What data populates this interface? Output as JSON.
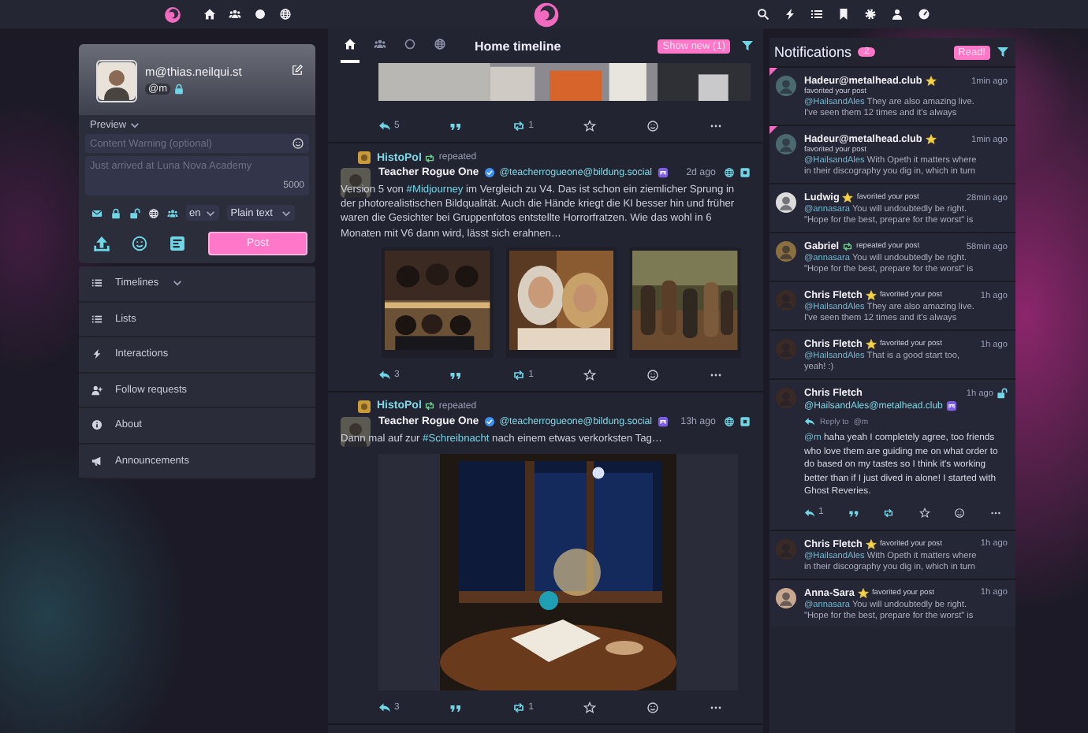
{
  "composer": {
    "account": "m@thias.neilqui.st",
    "handle": "@m",
    "locked": true,
    "preview": "Preview",
    "cw_placeholder": "Content Warning (optional)",
    "text_placeholder": "Just arrived at Luna Nova Academy",
    "counter": "5000",
    "language": "en",
    "format": "Plain text",
    "post": "Post"
  },
  "nav": [
    {
      "kind": "timelines",
      "label": "Timelines"
    },
    {
      "kind": "lists",
      "label": "Lists"
    },
    {
      "kind": "interactions",
      "label": "Interactions"
    },
    {
      "kind": "follow_requests",
      "label": "Follow requests"
    },
    {
      "kind": "about",
      "label": "About"
    },
    {
      "kind": "announcements",
      "label": "Announcements"
    }
  ],
  "timeline": {
    "tabs": [
      {
        "kind": "home",
        "selected": true
      },
      {
        "kind": "people",
        "selected": false
      },
      {
        "kind": "circle",
        "selected": false
      },
      {
        "kind": "globe",
        "selected": false
      }
    ],
    "title": "Home timeline",
    "show_new": "Show new (1)",
    "posts": [
      {
        "kind": "partial",
        "replies": "5",
        "boosts": "1"
      },
      {
        "kind": "full",
        "repeated_by": "HistoPol",
        "repeat_label": "repeated",
        "author": "Teacher Rogue One",
        "handle": "@teacherrogueone@bildung.social",
        "time": "2d ago",
        "text_before": "Version 5 von",
        "hashtag": "#Midjourney",
        "text_after": "im Vergleich zu V4. Das ist schon ein ziemlicher Sprung in der photorealistischen Bildqualität. Auch die Hände kriegt die KI besser hin und früher waren die Gesichter bei Gruppenfotos entstellte Horrorfratzen. Wie das wohl in 6 Monaten mit V6 dann wird, lässt sich erahnen…",
        "replies": "3",
        "boosts": "1"
      },
      {
        "kind": "full",
        "repeated_by": "HistoPol",
        "repeat_label": "repeated",
        "author": "Teacher Rogue One",
        "handle": "@teacherrogueone@bildung.social",
        "time": "13h ago",
        "text_before": "Dann mal auf zur",
        "hashtag": "#Schreibnacht",
        "text_after": "nach einem etwas verkorksten Tag…",
        "replies": "3",
        "boosts": "1"
      }
    ]
  },
  "notifications": {
    "title": "Notifications",
    "count": "2",
    "read_button": "Read!",
    "items": [
      {
        "kind": "favorite",
        "unread": true,
        "name": "Hadeur@metalhead.club",
        "action": "favorited your post",
        "time": "1min ago",
        "mention": "@HailsandAles",
        "lines": [
          "They are also amazing live.",
          "I've seen them 12 times and it's always"
        ]
      },
      {
        "kind": "favorite",
        "unread": true,
        "name": "Hadeur@metalhead.club",
        "action": "favorited your post",
        "time": "1min ago",
        "mention": "@HailsandAles",
        "lines": [
          "With Opeth it matters where",
          "in their discography you dig in, which in turn"
        ]
      },
      {
        "kind": "favorite",
        "unread": false,
        "name": "Ludwig",
        "action": "favorited your post",
        "time": "28min ago",
        "mention": "@annasara",
        "lines": [
          "You will undoubtedly be right.",
          "\"Hope for the best, prepare for the worst\" is"
        ]
      },
      {
        "kind": "repeat",
        "unread": false,
        "name": "Gabriel",
        "action": "repeated your post",
        "time": "58min ago",
        "mention": "@annasara",
        "lines": [
          "You will undoubtedly be right.",
          "\"Hope for the best, prepare for the worst\" is"
        ]
      },
      {
        "kind": "favorite",
        "unread": false,
        "name": "Chris Fletch",
        "action": "favorited your post",
        "time": "1h ago",
        "mention": "@HailsandAles",
        "lines": [
          "They are also amazing live.",
          "I've seen them 12 times and it's always"
        ]
      },
      {
        "kind": "favorite",
        "unread": false,
        "name": "Chris Fletch",
        "action": "favorited your post",
        "time": "1h ago",
        "mention": "@HailsandAles",
        "lines": [
          "That is a good start too,",
          "yeah! :)"
        ]
      },
      {
        "kind": "mention",
        "unread": false,
        "name": "Chris Fletch",
        "handle": "@HailsandAles@metalhead.club",
        "time": "1h ago",
        "reply_label": "Reply to",
        "reply_to": "@m",
        "mention": "@m",
        "text": "haha yeah I completely agree, too friends who love them are guiding me on what order to do based on my tastes so I think it's working better than if I just dived in alone! I started with Ghost Reveries.",
        "replies": "1"
      },
      {
        "kind": "favorite",
        "unread": false,
        "name": "Chris Fletch",
        "action": "favorited your post",
        "time": "1h ago",
        "mention": "@HailsandAles",
        "lines": [
          "With Opeth it matters where",
          "in their discography you dig in, which in turn"
        ]
      },
      {
        "kind": "favorite",
        "unread": false,
        "name": "Anna-Sara",
        "action": "favorited your post",
        "time": "1h ago",
        "mention": "@annasara",
        "lines": [
          "You will undoubtedly be right.",
          "\"Hope for the best, prepare for the worst\" is"
        ]
      }
    ]
  }
}
